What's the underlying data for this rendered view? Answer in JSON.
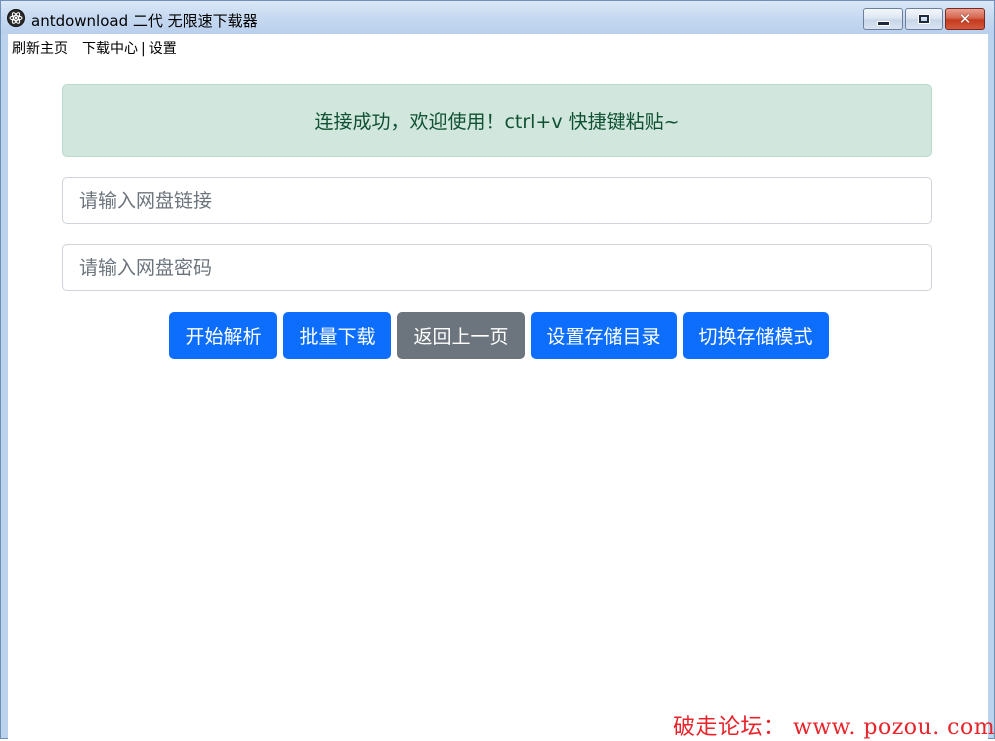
{
  "window": {
    "title": "antdownload 二代 无限速下载器",
    "icon": "atom-icon",
    "controls": {
      "minimize": "minimize-icon",
      "maximize": "maximize-icon",
      "close_glyph": "✕"
    }
  },
  "menu": {
    "refresh": "刷新主页",
    "downloads": "下载中心",
    "separator": "|",
    "settings": "设置"
  },
  "alert": {
    "message": "连接成功，欢迎使用！ctrl+v 快捷键粘贴~",
    "color": "#d1e7dd"
  },
  "inputs": {
    "link": {
      "value": "",
      "placeholder": "请输入网盘链接"
    },
    "password": {
      "value": "",
      "placeholder": "请输入网盘密码"
    }
  },
  "buttons": {
    "parse": "开始解析",
    "batch": "批量下载",
    "back": "返回上一页",
    "set_dir": "设置存储目录",
    "switch_mode": "切换存储模式"
  },
  "colors": {
    "primary": "#0d6efd",
    "secondary": "#6c757d",
    "watermark": "#e8232a"
  },
  "watermark": "破走论坛： www. pozou. com"
}
